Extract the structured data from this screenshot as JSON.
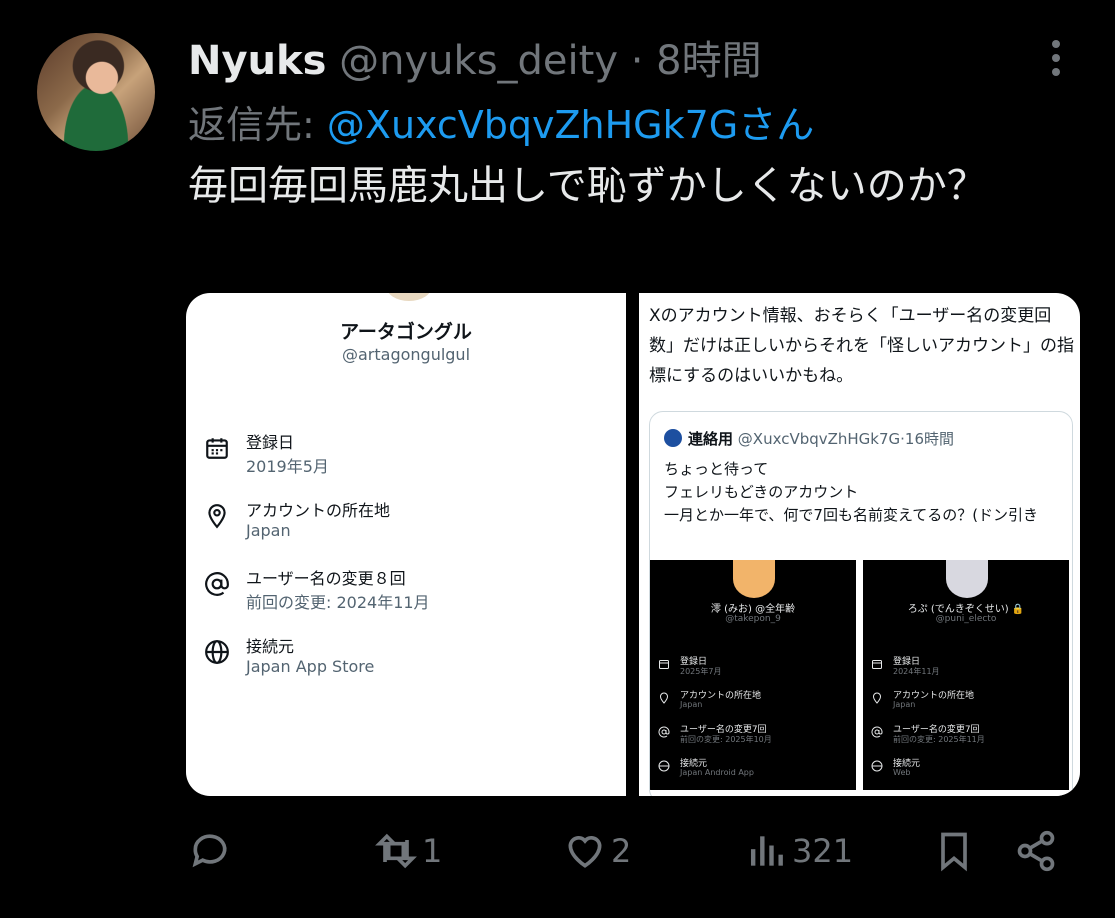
{
  "tweet": {
    "display_name": "Nyuks",
    "handle": "@nyuks_deity",
    "separator": "·",
    "time": "8時間",
    "reply_prefix": "返信先:",
    "reply_to": "@XuxcVbqvZhHGk7Gさん",
    "text": "毎回毎回馬鹿丸出しで恥ずかしくないのか？"
  },
  "left_image": {
    "name": "アータゴングル",
    "handle": "@artagongulgul",
    "rows": [
      {
        "icon": "calendar-icon",
        "title": "登録日",
        "value": "2019年5月"
      },
      {
        "icon": "location-pin-icon",
        "title": "アカウントの所在地",
        "value": "Japan"
      },
      {
        "icon": "at-sign-icon",
        "title": "ユーザー名の変更８回",
        "value": "前回の変更: 2024年11月"
      },
      {
        "icon": "globe-icon",
        "title": "接続元",
        "value": "Japan App Store"
      }
    ]
  },
  "right_image": {
    "text": "Xのアカウント情報、おそらく「ユーザー名の変更回数」だけは正しいからそれを「怪しいアカウント」の指標にするのはいいかもね。",
    "quote": {
      "name": "連絡用",
      "handle_time": "@XuxcVbqvZhHGk7G·16時間",
      "lines": [
        "ちょっと待って",
        "フェレリもどきのアカウント",
        "一月とか一年で、何で7回も名前変えてるの？(ドン引き"
      ],
      "cards": [
        {
          "name": "澪 (みお) @全年齢",
          "handle": "@takepon_9",
          "rows": [
            {
              "icon": "calendar-icon",
              "a": "登録日",
              "b": "2025年7月"
            },
            {
              "icon": "location-pin-icon",
              "a": "アカウントの所在地",
              "b": "Japan"
            },
            {
              "icon": "at-sign-icon",
              "a": "ユーザー名の変更7回",
              "b": "前回の変更: 2025年10月"
            },
            {
              "icon": "globe-icon",
              "a": "接続元",
              "b": "Japan Android App"
            }
          ]
        },
        {
          "name": "ろぷ (でんきぞくせい) 🔒",
          "handle": "@puni_electo",
          "rows": [
            {
              "icon": "calendar-icon",
              "a": "登録日",
              "b": "2024年11月"
            },
            {
              "icon": "location-pin-icon",
              "a": "アカウントの所在地",
              "b": "Japan"
            },
            {
              "icon": "at-sign-icon",
              "a": "ユーザー名の変更7回",
              "b": "前回の変更: 2025年11月"
            },
            {
              "icon": "globe-icon",
              "a": "接続元",
              "b": "Web"
            }
          ]
        }
      ]
    }
  },
  "actions": {
    "reply_count": "",
    "retweet_count": "1",
    "like_count": "2",
    "views_count": "321"
  },
  "colors": {
    "background": "#000000",
    "accent": "#1d9bf0",
    "muted": "#71767b",
    "text": "#e7e9ea"
  }
}
